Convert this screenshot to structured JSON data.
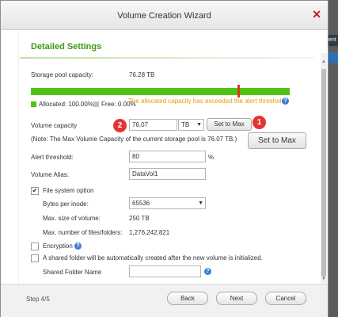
{
  "window": {
    "title": "Volume Creation Wizard",
    "close_symbol": "✕"
  },
  "background": {
    "tab_text": "ent U"
  },
  "section": {
    "title": "Detailed Settings"
  },
  "storage_pool": {
    "label": "Storage pool capacity:",
    "value": "76.28 TB",
    "allocated_fraction": 1.0,
    "alert_marker_fraction": 0.8,
    "legend_allocated": "Allocated: 100.00%",
    "legend_free": "Free: 0.00%",
    "warning": "The allocated capacity has exceeded the alert threshold.",
    "colors": {
      "allocated": "#4fc312",
      "free": "#c0c0c0",
      "marker": "#d9381e",
      "warning": "#e0a000"
    }
  },
  "volume_capacity": {
    "label": "Volume capacity",
    "value": "76.07",
    "unit": "TB",
    "set_max_label": "Set to Max",
    "note": "(Note: The Max Volume Capacity of the current storage pool is 76.07 TB.)"
  },
  "callout": {
    "badge1": "1",
    "badge2": "2",
    "set_max_label": "Set to Max"
  },
  "alert_threshold": {
    "label": "Alert threshold:",
    "value": "80",
    "unit": "%"
  },
  "volume_alias": {
    "label": "Volume Alias:",
    "value": "DataVol1"
  },
  "file_system": {
    "label": "File system option",
    "checked": true,
    "bytes_per_inode_label": "Bytes per inode:",
    "bytes_per_inode_value": "65536",
    "max_size_label": "Max. size of volume:",
    "max_size_value": "250 TB",
    "max_files_label": "Max. number of files/folders:",
    "max_files_value": "1,276,242,821"
  },
  "encryption": {
    "label": "Encryption",
    "checked": false
  },
  "shared_folder": {
    "label": "A shared folder will be automatically created after the new volume is initialized.",
    "checked": false,
    "name_label": "Shared Folder Name",
    "name_value": ""
  },
  "help_icon": "?",
  "footer": {
    "step": "Step 4/5",
    "back": "Back",
    "next": "Next",
    "cancel": "Cancel"
  }
}
